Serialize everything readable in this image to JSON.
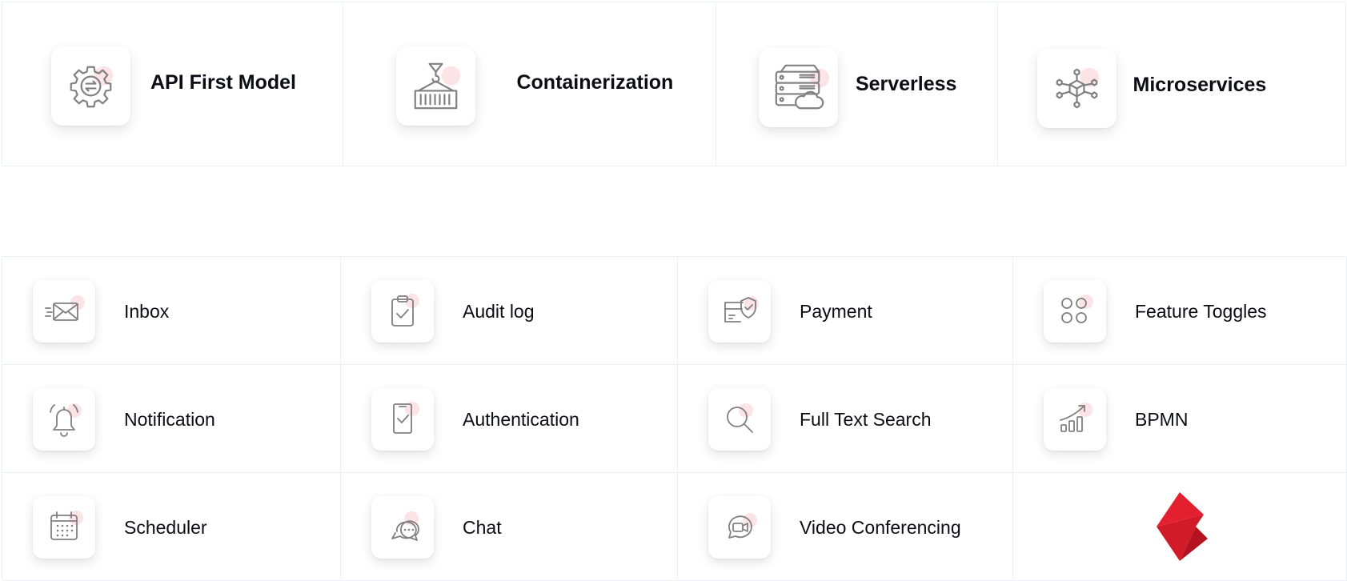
{
  "top_features": [
    {
      "label": "API First Model",
      "icon": "gear-exchange-icon"
    },
    {
      "label": "Containerization",
      "icon": "crane-container-icon"
    },
    {
      "label": "Serverless",
      "icon": "server-cloud-icon"
    },
    {
      "label": "Microservices",
      "icon": "cube-network-icon"
    }
  ],
  "modules": [
    {
      "label": "Inbox",
      "icon": "envelope-icon"
    },
    {
      "label": "Audit log",
      "icon": "clipboard-check-icon"
    },
    {
      "label": "Payment",
      "icon": "card-shield-icon"
    },
    {
      "label": "Feature Toggles",
      "icon": "grid-circles-icon"
    },
    {
      "label": "Notification",
      "icon": "bell-icon"
    },
    {
      "label": "Authentication",
      "icon": "phone-check-icon"
    },
    {
      "label": "Full Text Search",
      "icon": "magnifier-icon"
    },
    {
      "label": "BPMN",
      "icon": "growth-chart-icon"
    },
    {
      "label": "Scheduler",
      "icon": "calendar-icon"
    },
    {
      "label": "Chat",
      "icon": "chat-bubbles-icon"
    },
    {
      "label": "Video Conferencing",
      "icon": "video-bubble-icon"
    }
  ],
  "brand_logo": "red-chevron-logo",
  "colors": {
    "accent_dot": "#fbe3e6",
    "icon_stroke": "#808080",
    "logo_red": "#e3202f",
    "logo_dark": "#b5121f",
    "border": "#eceff3"
  }
}
